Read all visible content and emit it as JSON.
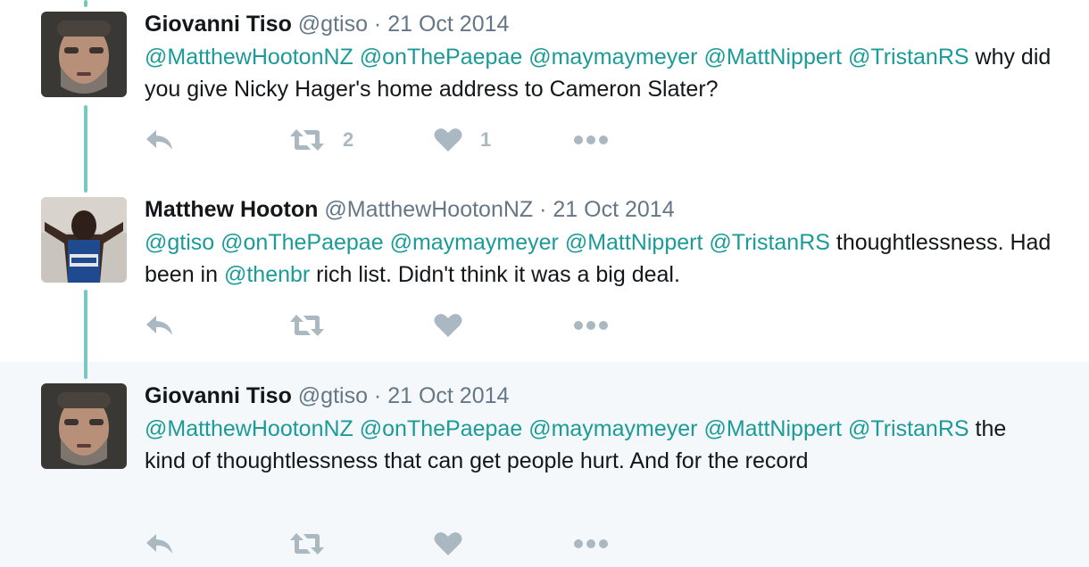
{
  "colors": {
    "mention": "#1b9b98",
    "connector": "#76c9c3",
    "icon": "#aab8c2",
    "muted": "#657786",
    "highlight_bg": "#f5f8fa"
  },
  "icons": [
    "reply-icon",
    "retweet-icon",
    "heart-icon",
    "more-icon"
  ],
  "tweets": [
    {
      "name": "Giovanni Tiso",
      "handle": "@gtiso",
      "sep": " · ",
      "date": "21 Oct 2014",
      "text": [
        {
          "t": "@MatthewHootonNZ",
          "m": true
        },
        {
          "t": " "
        },
        {
          "t": "@onThePaepae",
          "m": true
        },
        {
          "t": " "
        },
        {
          "t": "@maymaymeyer",
          "m": true
        },
        {
          "t": " "
        },
        {
          "t": "@MattNippert",
          "m": true
        },
        {
          "t": " "
        },
        {
          "t": "@TristanRS",
          "m": true
        },
        {
          "t": " why did you give Nicky Hager's home address to Cameron Slater?"
        }
      ],
      "retweets": "2",
      "likes": "1"
    },
    {
      "name": "Matthew Hooton",
      "handle": "@MatthewHootonNZ",
      "sep": " · ",
      "date": "21 Oct 2014",
      "text": [
        {
          "t": "@gtiso",
          "m": true
        },
        {
          "t": " "
        },
        {
          "t": "@onThePaepae",
          "m": true
        },
        {
          "t": " "
        },
        {
          "t": "@maymaymeyer",
          "m": true
        },
        {
          "t": " "
        },
        {
          "t": "@MattNippert",
          "m": true
        },
        {
          "t": " "
        },
        {
          "t": "@TristanRS",
          "m": true
        },
        {
          "t": " thoughtlessness. Had been in "
        },
        {
          "t": "@thenbr",
          "m": true
        },
        {
          "t": " rich list. Didn't think it was a big deal."
        }
      ],
      "retweets": "",
      "likes": ""
    },
    {
      "name": "Giovanni Tiso",
      "handle": "@gtiso",
      "sep": " · ",
      "date": "21 Oct 2014",
      "text": [
        {
          "t": "@MatthewHootonNZ",
          "m": true
        },
        {
          "t": " "
        },
        {
          "t": "@onThePaepae",
          "m": true
        },
        {
          "t": " "
        },
        {
          "t": "@maymaymeyer",
          "m": true
        },
        {
          "t": " "
        },
        {
          "t": "@MattNippert",
          "m": true
        },
        {
          "t": " "
        },
        {
          "t": "@TristanRS",
          "m": true
        },
        {
          "t": " the kind of thoughtlessness that can get people hurt. And for the record"
        }
      ],
      "retweets": "",
      "likes": ""
    }
  ]
}
